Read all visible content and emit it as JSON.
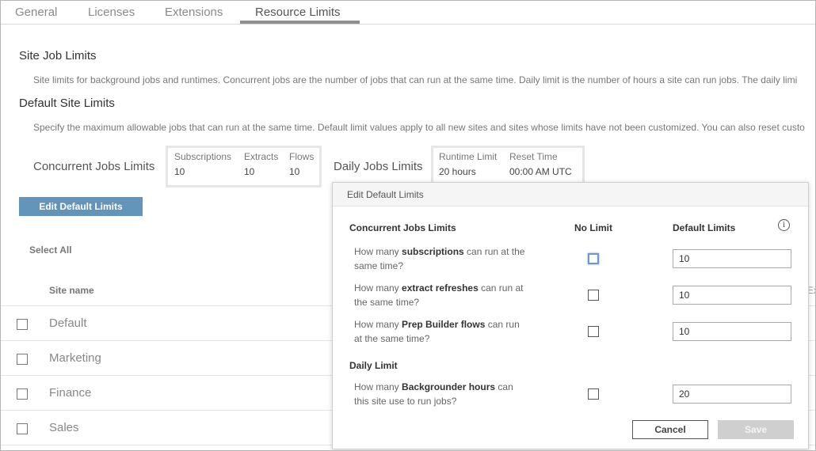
{
  "tabs": [
    {
      "label": "General"
    },
    {
      "label": "Licenses"
    },
    {
      "label": "Extensions"
    },
    {
      "label": "Resource Limits",
      "active": true
    }
  ],
  "site_job_limits": {
    "title": "Site Job Limits",
    "description": "Site limits for background jobs and runtimes. Concurrent jobs are the number of jobs that can run at the same time. Daily limit is the number of hours a site can run jobs. The daily limi"
  },
  "default_site_limits": {
    "title": "Default Site Limits",
    "description": "Specify the maximum allowable jobs that can run at the same time. Default limit values apply to all new sites and sites whose limits have not been customized. You can also reset custo"
  },
  "concurrent": {
    "label": "Concurrent Jobs Limits",
    "columns": [
      {
        "header": "Subscriptions",
        "value": "10"
      },
      {
        "header": "Extracts",
        "value": "10"
      },
      {
        "header": "Flows",
        "value": "10"
      }
    ]
  },
  "daily": {
    "label": "Daily Jobs Limits",
    "columns": [
      {
        "header": "Runtime Limit",
        "value": "20 hours"
      },
      {
        "header": "Reset Time",
        "value": "00:00 AM UTC"
      }
    ]
  },
  "edit_button_label": "Edit Default Limits",
  "select_all_label": "Select All",
  "table": {
    "site_name_header": "Site name",
    "extra_header": "Ex",
    "rows": [
      {
        "name": "Default"
      },
      {
        "name": "Marketing"
      },
      {
        "name": "Finance"
      },
      {
        "name": "Sales"
      }
    ]
  },
  "modal": {
    "title": "Edit Default Limits",
    "concurrent_header": "Concurrent Jobs Limits",
    "no_limit_header": "No Limit",
    "default_limits_header": "Default Limits",
    "info_icon": "info-icon",
    "questions": [
      {
        "pre": "How many ",
        "bold": "subscriptions",
        "post": " can run at the same time?",
        "value": "10"
      },
      {
        "pre": "How many ",
        "bold": "extract refreshes",
        "post": " can run at the same time?",
        "value": "10"
      },
      {
        "pre": "How many ",
        "bold": "Prep Builder flows",
        "post": " can run at the same time?",
        "value": "10"
      }
    ],
    "daily_header": "Daily Limit",
    "daily_question": {
      "pre": "How many ",
      "bold": "Backgrounder hours",
      "post": " can this site use to run jobs?",
      "value": "20"
    },
    "cancel_label": "Cancel",
    "save_label": "Save"
  },
  "colors": {
    "accent": "#6394ba",
    "save_disabled": "#cfcfcf",
    "focus": "#6f99c9"
  }
}
